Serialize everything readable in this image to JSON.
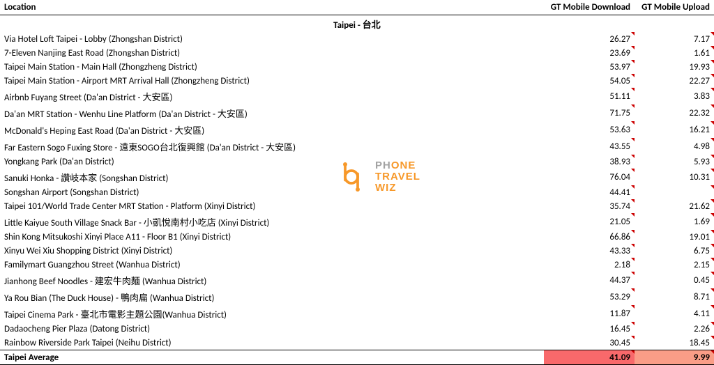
{
  "columns": {
    "location": "Location",
    "download": "GT Mobile Download",
    "upload": "GT Mobile Upload"
  },
  "section_title": "Taipei - 台北",
  "rows": [
    {
      "location": "Via Hotel Loft Taipei - Lobby (Zhongshan District)",
      "download": "26.27",
      "upload": "7.17"
    },
    {
      "location": "7-Eleven Nanjing East Road (Zhongshan District)",
      "download": "23.69",
      "upload": "1.61"
    },
    {
      "location": "Taipei Main Station - Main Hall (Zhongzheng District)",
      "download": "53.97",
      "upload": "19.93"
    },
    {
      "location": "Taipei Main Station - Airport MRT Arrival Hall (Zhongzheng District)",
      "download": "54.05",
      "upload": "22.27"
    },
    {
      "location": "Airbnb Fuyang Street (Da'an District - 大安區)",
      "download": "51.11",
      "upload": "3.83"
    },
    {
      "location": "Da'an MRT Station - Wenhu Line Platform (Da'an District - 大安區)",
      "download": "71.75",
      "upload": "22.32"
    },
    {
      "location": "McDonald's Heping East Road (Da'an District - 大安區)",
      "download": "53.63",
      "upload": "16.21"
    },
    {
      "location": "Far Eastern Sogo Fuxing Store - 遠東SOGO台北復興館 (Da'an District - 大安區)",
      "download": "43.55",
      "upload": "4.98"
    },
    {
      "location": "Yongkang Park (Da'an District)",
      "download": "38.93",
      "upload": "5.93"
    },
    {
      "location": "Sanuki Honka - 讚岐本家 (Songshan District)",
      "download": "76.04",
      "upload": "10.31"
    },
    {
      "location": "Songshan Airport (Songshan District)",
      "download": "44.41",
      "upload": ""
    },
    {
      "location": "Taipei 101/World Trade Center MRT Station - Platform (Xinyi District)",
      "download": "35.74",
      "upload": "21.62"
    },
    {
      "location": "Little Kaiyue South Village Snack Bar - 小凱悅南村小吃店 (Xinyi District)",
      "download": "21.05",
      "upload": "1.69"
    },
    {
      "location": "Shin Kong Mitsukoshi Xinyi Place A11 - Floor B1 (Xinyi District)",
      "download": "66.86",
      "upload": "19.01"
    },
    {
      "location": "Xinyu Wei Xiu Shopping District (Xinyi District)",
      "download": "43.33",
      "upload": "6.75"
    },
    {
      "location": "Familymart Guangzhou Street (Wanhua District)",
      "download": "2.18",
      "upload": "2.15"
    },
    {
      "location": "Jianhong Beef Noodles - 建宏牛肉麵 (Wanhua District)",
      "download": "44.37",
      "upload": "0.45"
    },
    {
      "location": "Ya Rou Bian (The Duck House) - 鴨肉扁 (Wanhua District)",
      "download": "53.29",
      "upload": "8.71"
    },
    {
      "location": "Taipei Cinema Park - 臺北市電影主題公園(Wanhua District)",
      "download": "11.87",
      "upload": "4.11"
    },
    {
      "location": "Dadaocheng Pier Plaza (Datong District)",
      "download": "16.45",
      "upload": "2.26"
    },
    {
      "location": "Rainbow Riverside Park Taipei (Neihu District)",
      "download": "30.45",
      "upload": "18.45"
    }
  ],
  "average": {
    "label": "Taipei Average",
    "download": "41.09",
    "upload": "9.99"
  },
  "watermark": {
    "line1a": "PH",
    "line1b": "ONE",
    "line2": "TRAVEL",
    "line3": "WIZ"
  },
  "chart_data": {
    "type": "table",
    "title": "GT Mobile speed test results — Taipei",
    "columns": [
      "Location",
      "GT Mobile Download",
      "GT Mobile Upload"
    ],
    "rows": [
      [
        "Via Hotel Loft Taipei - Lobby (Zhongshan District)",
        26.27,
        7.17
      ],
      [
        "7-Eleven Nanjing East Road (Zhongshan District)",
        23.69,
        1.61
      ],
      [
        "Taipei Main Station - Main Hall (Zhongzheng District)",
        53.97,
        19.93
      ],
      [
        "Taipei Main Station - Airport MRT Arrival Hall (Zhongzheng District)",
        54.05,
        22.27
      ],
      [
        "Airbnb Fuyang Street (Da'an District - 大安區)",
        51.11,
        3.83
      ],
      [
        "Da'an MRT Station - Wenhu Line Platform (Da'an District - 大安區)",
        71.75,
        22.32
      ],
      [
        "McDonald's Heping East Road (Da'an District - 大安區)",
        53.63,
        16.21
      ],
      [
        "Far Eastern Sogo Fuxing Store - 遠東SOGO台北復興館 (Da'an District - 大安區)",
        43.55,
        4.98
      ],
      [
        "Yongkang Park (Da'an District)",
        38.93,
        5.93
      ],
      [
        "Sanuki Honka - 讚岐本家 (Songshan District)",
        76.04,
        10.31
      ],
      [
        "Songshan Airport (Songshan District)",
        44.41,
        null
      ],
      [
        "Taipei 101/World Trade Center MRT Station - Platform (Xinyi District)",
        35.74,
        21.62
      ],
      [
        "Little Kaiyue South Village Snack Bar - 小凱悅南村小吃店 (Xinyi District)",
        21.05,
        1.69
      ],
      [
        "Shin Kong Mitsukoshi Xinyi Place A11 - Floor B1 (Xinyi District)",
        66.86,
        19.01
      ],
      [
        "Xinyu Wei Xiu Shopping District (Xinyi District)",
        43.33,
        6.75
      ],
      [
        "Familymart Guangzhou Street (Wanhua District)",
        2.18,
        2.15
      ],
      [
        "Jianhong Beef Noodles - 建宏牛肉麵 (Wanhua District)",
        44.37,
        0.45
      ],
      [
        "Ya Rou Bian (The Duck House) - 鴨肉扁 (Wanhua District)",
        53.29,
        8.71
      ],
      [
        "Taipei Cinema Park - 臺北市電影主題公園(Wanhua District)",
        11.87,
        4.11
      ],
      [
        "Dadaocheng Pier Plaza (Datong District)",
        16.45,
        2.26
      ],
      [
        "Rainbow Riverside Park Taipei (Neihu District)",
        30.45,
        18.45
      ]
    ],
    "summary": {
      "label": "Taipei Average",
      "download": 41.09,
      "upload": 9.99
    }
  }
}
